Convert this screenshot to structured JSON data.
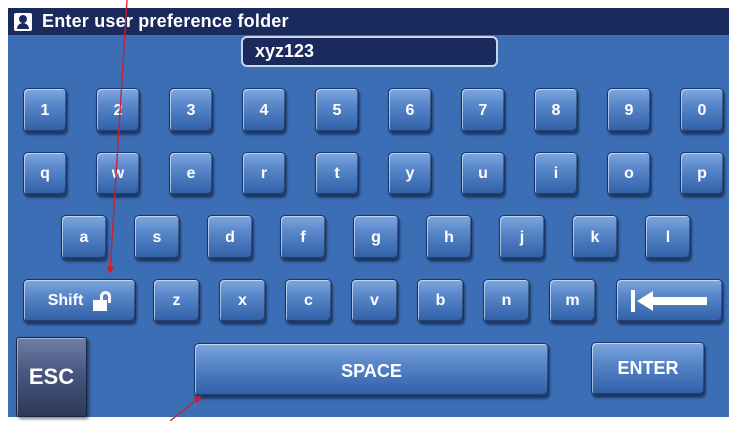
{
  "title": {
    "text": "Enter user preference folder",
    "icon": "person-icon"
  },
  "input": {
    "value": "xyz123"
  },
  "keys": {
    "digits": [
      "1",
      "2",
      "3",
      "4",
      "5",
      "6",
      "7",
      "8",
      "9",
      "0"
    ],
    "row_q": [
      "q",
      "w",
      "e",
      "r",
      "t",
      "y",
      "u",
      "i",
      "o",
      "p"
    ],
    "row_a": [
      "a",
      "s",
      "d",
      "f",
      "g",
      "h",
      "j",
      "k",
      "l"
    ],
    "row_z": [
      "z",
      "x",
      "c",
      "v",
      "b",
      "n",
      "m"
    ],
    "shift": "Shift",
    "esc": "ESC",
    "space": "SPACE",
    "enter": "ENTER"
  },
  "colors": {
    "background": "#3b6eb5",
    "titlebar": "#1b2a5c",
    "key": "#4c7cc4",
    "annotation_arrow": "#cc1f2b"
  }
}
